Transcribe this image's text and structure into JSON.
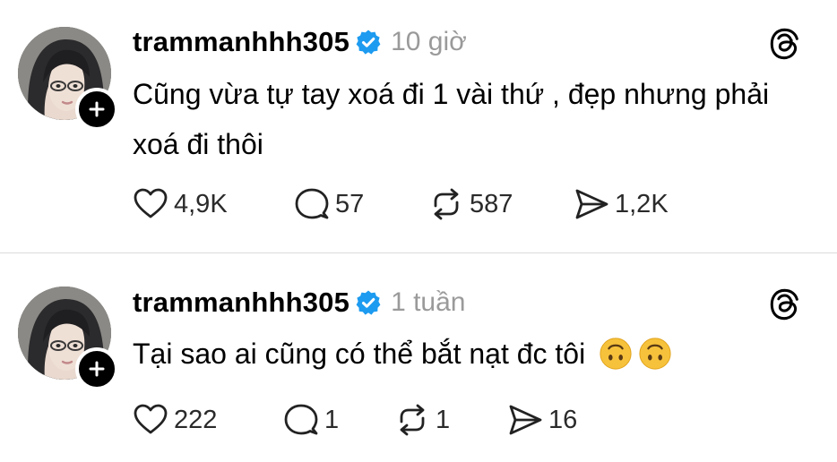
{
  "colors": {
    "verified_badge": "#1d9bf0",
    "timestamp": "#9a9a9a",
    "divider": "#dbdbdb",
    "text": "#000000"
  },
  "icons": {
    "like": "heart-icon",
    "reply": "comment-bubble-icon",
    "repost": "repost-arrows-icon",
    "share": "send-icon",
    "brand": "threads-logo-icon",
    "follow": "plus-icon",
    "verified": "verified-badge-icon",
    "emoji": "upside-down-face-emoji"
  },
  "posts": [
    {
      "username": "trammanhhh305",
      "timestamp": "10 giờ",
      "text": "Cũng vừa tự tay xoá đi 1 vài thứ , đẹp nhưng phải xoá đi thôi",
      "emoji_count": 0,
      "likes": "4,9K",
      "replies": "57",
      "reposts": "587",
      "shares": "1,2K"
    },
    {
      "username": "trammanhhh305",
      "timestamp": "1 tuần",
      "text": "Tại sao ai cũng có thể bắt nạt đc tôi",
      "emoji_count": 2,
      "likes": "222",
      "replies": "1",
      "reposts": "1",
      "shares": "16"
    }
  ]
}
